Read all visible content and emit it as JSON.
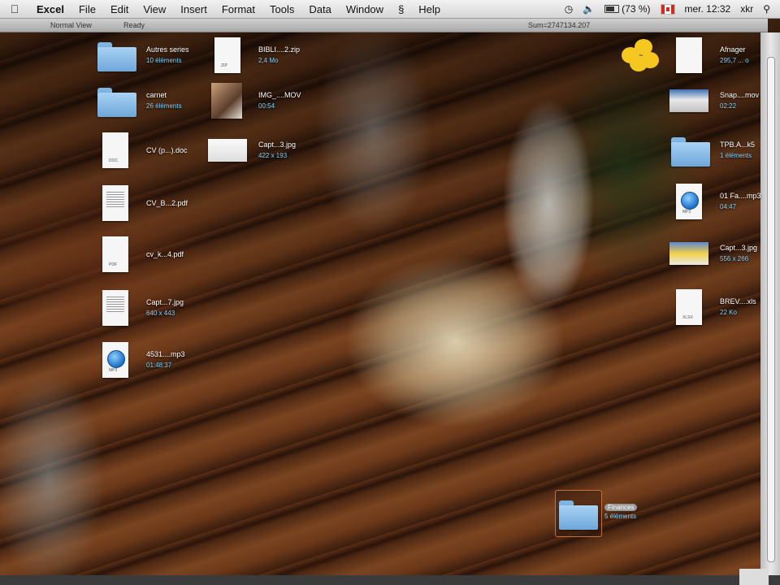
{
  "menubar": {
    "app": "Excel",
    "items": [
      "File",
      "Edit",
      "View",
      "Insert",
      "Format",
      "Tools",
      "Data",
      "Window",
      "Help"
    ],
    "battery": "(73 %)",
    "clock": "mer. 12:32",
    "user": "xkr"
  },
  "statusbar": {
    "view": "Normal View",
    "ready": "Ready",
    "sum": "Sum=2747134.207"
  },
  "desktop": {
    "col1": [
      {
        "name": "Autres series",
        "sub": "10 éléments",
        "kind": "folder"
      },
      {
        "name": "carnet",
        "sub": "26 éléments",
        "kind": "folder"
      },
      {
        "name": "CV (p...).doc",
        "sub": "",
        "kind": "doc",
        "tag": "DOC"
      },
      {
        "name": "CV_B...2.pdf",
        "sub": "",
        "kind": "doc",
        "tag": ""
      },
      {
        "name": "cv_k...4.pdf",
        "sub": "",
        "kind": "doc",
        "tag": "PDF"
      },
      {
        "name": "Capt...7.jpg",
        "sub": "640 x 443",
        "kind": "doc",
        "tag": "PDF"
      },
      {
        "name": "4531....mp3",
        "sub": "01:48:37",
        "kind": "mp3",
        "tag": "MP3"
      }
    ],
    "col2": [
      {
        "name": "BIBLI....2.zip",
        "sub": "2,4 Mo",
        "kind": "doc",
        "tag": "ZIP"
      },
      {
        "name": "IMG_....MOV",
        "sub": "00:54",
        "kind": "photo"
      },
      {
        "name": "Capt...3.jpg",
        "sub": "422 x 193",
        "kind": "thumb"
      }
    ],
    "col3": [
      {
        "name": "Afnager",
        "sub": "295,7 ... o",
        "kind": "doc",
        "tag": ""
      },
      {
        "name": "Snap....mov",
        "sub": "02:22",
        "kind": "thumb"
      },
      {
        "name": "TPB.A...k5",
        "sub": "1 éléments",
        "kind": "folder"
      },
      {
        "name": "01 Fa....mp3",
        "sub": "04:47",
        "kind": "mp3",
        "tag": "MP3"
      },
      {
        "name": "Capt...3.jpg",
        "sub": "556 x 266",
        "kind": "thumb"
      },
      {
        "name": "BREV....xls",
        "sub": "22 Ko",
        "kind": "doc",
        "tag": "XLSX"
      }
    ],
    "selected": {
      "name": "Finances",
      "sub": "5 éléments"
    }
  }
}
